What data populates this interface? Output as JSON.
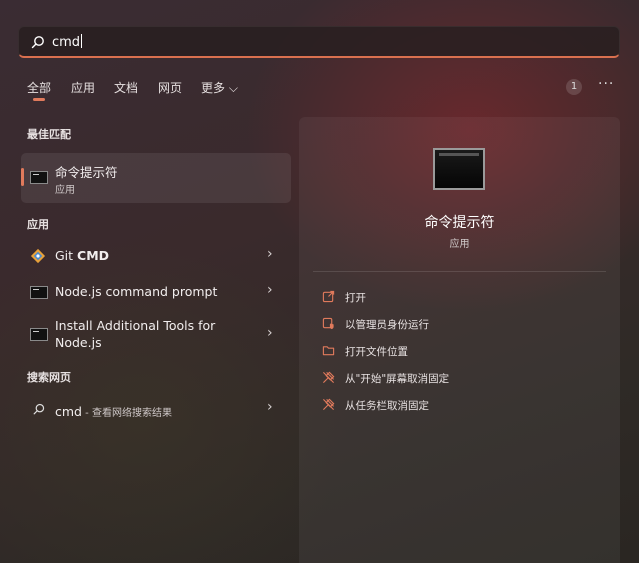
{
  "search": {
    "value": "cmd"
  },
  "tabs": [
    {
      "label": "全部"
    },
    {
      "label": "应用"
    },
    {
      "label": "文档"
    },
    {
      "label": "网页"
    },
    {
      "label": "更多 ⌵"
    }
  ],
  "badge_count": "1",
  "more_options": "···",
  "best_match": {
    "heading": "最佳匹配",
    "title": "命令提示符",
    "subtitle": "应用"
  },
  "apps": {
    "heading": "应用",
    "items": [
      {
        "prefix": "Git ",
        "bold": "CMD",
        "icon": "git-icon"
      },
      {
        "title": "Node.js command prompt",
        "icon": "terminal-icon"
      },
      {
        "title_line1": "Install Additional Tools for",
        "title_line2": "Node.js",
        "icon": "terminal-icon"
      }
    ]
  },
  "web": {
    "heading": "搜索网页",
    "query": "cmd",
    "suffix": " - 查看网络搜索结果"
  },
  "detail": {
    "title": "命令提示符",
    "subtitle": "应用",
    "actions": [
      {
        "label": "打开",
        "icon": "open-external-icon"
      },
      {
        "label": "以管理员身份运行",
        "icon": "run-as-admin-icon"
      },
      {
        "label": "打开文件位置",
        "icon": "folder-icon"
      },
      {
        "label": "从\"开始\"屏幕取消固定",
        "icon": "unpin-icon"
      },
      {
        "label": "从任务栏取消固定",
        "icon": "unpin-icon"
      }
    ]
  },
  "colors": {
    "accent": "#e07a5c",
    "icon_accent": "#e07a5c"
  }
}
